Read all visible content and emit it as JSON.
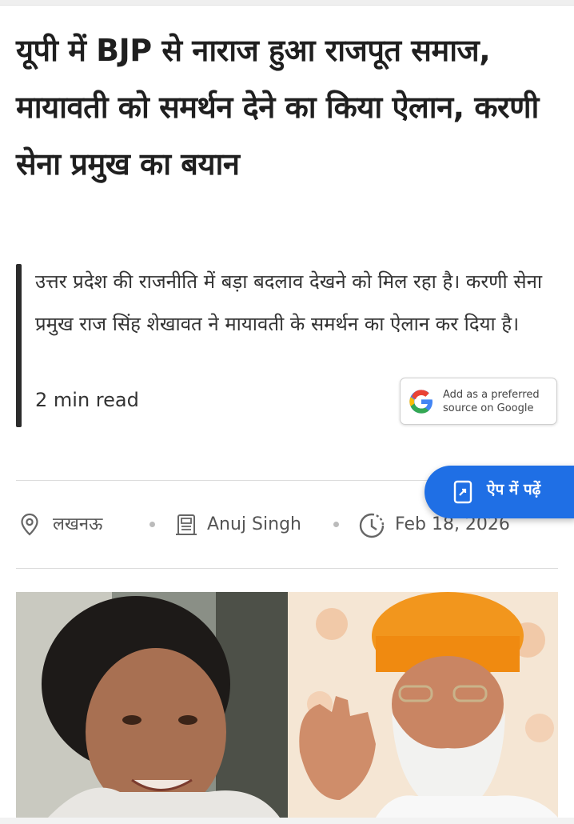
{
  "article": {
    "headline": "यूपी में BJP से नाराज हुआ राजपूत समाज, मायावती को समर्थन देने का किया ऐलान, करणी सेना प्रमुख का बयान",
    "summary": "उत्तर प्रदेश की राजनीति में बड़ा बदलाव देखने को मिल रहा है। करणी सेना प्रमुख राज सिंह शेखावत ने मायावती के समर्थन का ऐलान कर दिया है।",
    "read_time": "2 min read"
  },
  "google_source": {
    "line1": "Add as a preferred",
    "line2": "source on Google",
    "icon": "google-g-icon"
  },
  "app_button": {
    "label": "ऐप में पढ़ें",
    "icon": "phone-open-icon",
    "color": "#1f6fe5"
  },
  "meta": {
    "location": "लखनऊ",
    "author": "Anuj Singh",
    "date": "Feb 18, 2026",
    "location_icon": "location-pin-icon",
    "author_icon": "newspaper-icon",
    "date_icon": "clock-icon"
  },
  "image": {
    "subject": "article-photo"
  }
}
